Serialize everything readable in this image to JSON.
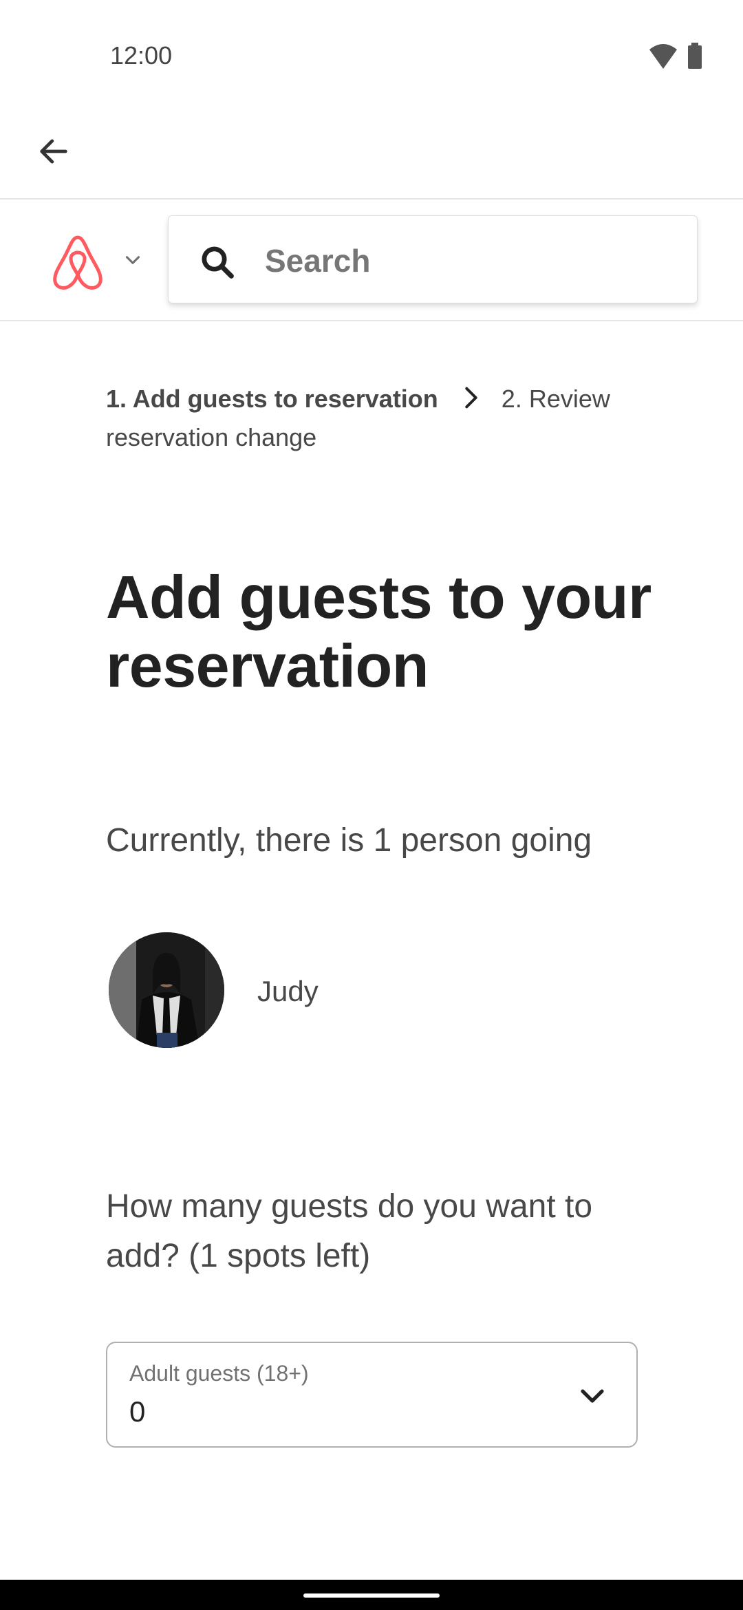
{
  "status_bar": {
    "time": "12:00",
    "icons": [
      "wifi-icon",
      "battery-icon"
    ]
  },
  "app_bar": {
    "back_icon": "arrow-left-icon"
  },
  "header": {
    "logo_icon": "airbnb-logo-icon",
    "logo_color": "#FF5A5F",
    "search_placeholder": "Search"
  },
  "breadcrumb": {
    "step1": "1. Add guests to reservation",
    "step2": "2. Review reservation change"
  },
  "page": {
    "title": "Add guests to your reservation",
    "current_text": "Currently, there is 1 person going",
    "guests": [
      {
        "name": "Judy"
      }
    ],
    "question": "How many guests do you want to add? (1 spots left)"
  },
  "adult_select": {
    "label": "Adult guests (18+)",
    "value": "0"
  }
}
